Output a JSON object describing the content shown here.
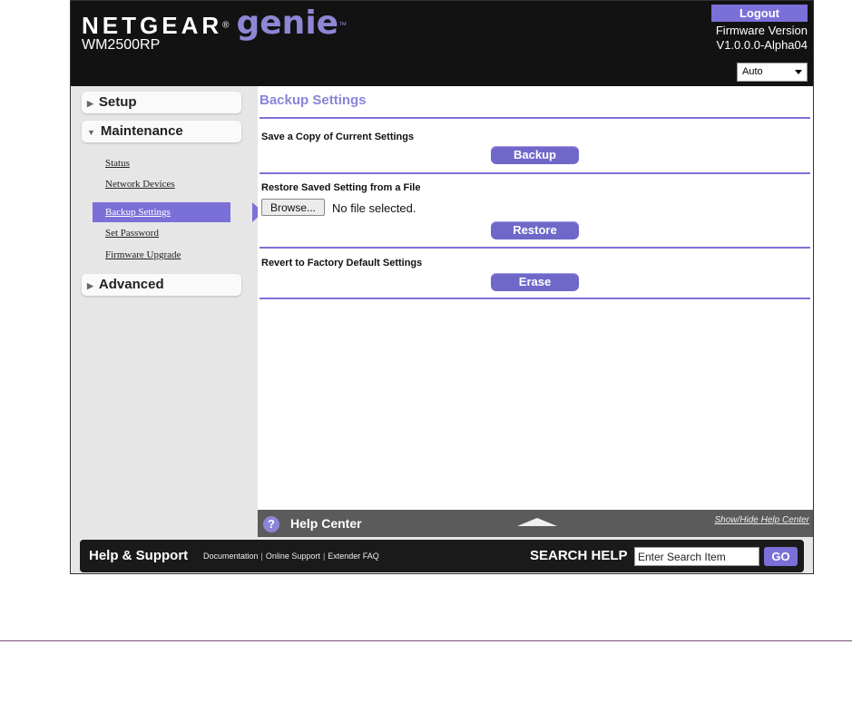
{
  "header": {
    "brand_netgear": "NETGEAR",
    "brand_reg": "®",
    "brand_genie": "genie",
    "brand_tm": "™",
    "model": "WM2500RP",
    "logout_label": "Logout",
    "firmware_label": "Firmware Version",
    "firmware_version": "V1.0.0.0-Alpha04",
    "language_selected": "Auto"
  },
  "sidebar": {
    "setup": "Setup",
    "maintenance": "Maintenance",
    "advanced": "Advanced",
    "items": [
      {
        "label": "Status"
      },
      {
        "label": "Network Devices"
      },
      {
        "label": "Backup Settings"
      },
      {
        "label": "Set Password"
      },
      {
        "label": "Firmware Upgrade"
      }
    ]
  },
  "main": {
    "title": "Backup Settings",
    "save_copy_label": "Save a Copy of Current Settings",
    "backup_button": "Backup",
    "restore_label": "Restore Saved Setting from a File",
    "browse_button": "Browse...",
    "no_file": "No file selected.",
    "restore_button": "Restore",
    "revert_label": "Revert to Factory Default Settings",
    "erase_button": "Erase"
  },
  "help_center": {
    "icon_glyph": "?",
    "label": "Help Center",
    "toggle": "Show/Hide Help Center"
  },
  "footer": {
    "title": "Help & Support",
    "links": [
      "Documentation",
      "Online Support",
      "Extender FAQ"
    ],
    "search_label": "SEARCH HELP",
    "search_value": "Enter Search Item",
    "go_button": "GO"
  },
  "colors": {
    "accent": "#7b70d8",
    "genie": "#8f86d6",
    "header_bg": "#121212"
  }
}
